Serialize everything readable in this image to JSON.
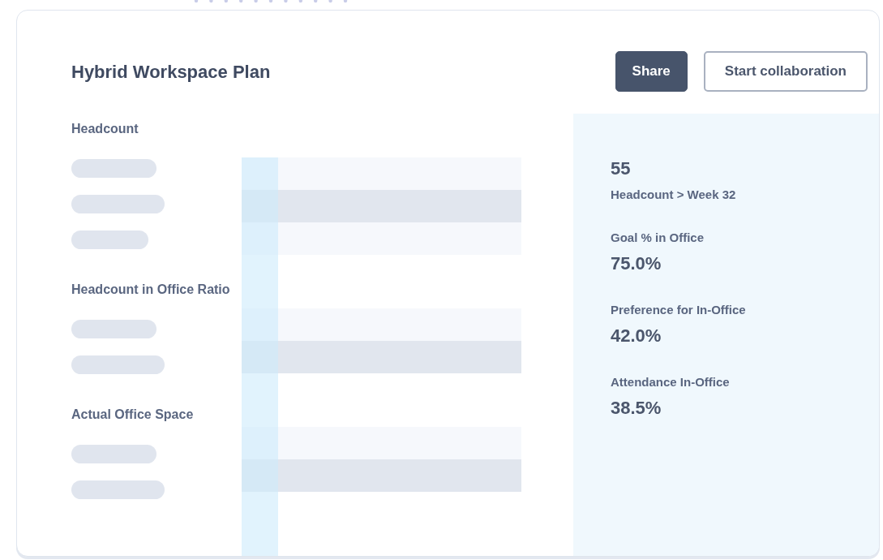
{
  "title": "Hybrid Workspace Plan",
  "buttons": [
    {
      "label": "Share",
      "kind": "primary"
    },
    {
      "label": "Start collaboration",
      "kind": "outline"
    }
  ],
  "sections": [
    {
      "label": "Headcount",
      "rows": [
        {
          "kind": "skeleton"
        },
        {
          "kind": "skeleton"
        },
        {
          "kind": "skeleton"
        }
      ]
    },
    {
      "label": "Headcount in Office Ratio",
      "rows": [
        {
          "kind": "skeleton"
        },
        {
          "kind": "skeleton"
        }
      ]
    },
    {
      "label": "Actual Office Space",
      "rows": [
        {
          "kind": "skeleton"
        },
        {
          "kind": "skeleton"
        }
      ]
    }
  ],
  "stats": [
    {
      "kind": "value_first",
      "value": "55",
      "label": "Headcount > Week 32"
    },
    {
      "kind": "label_first",
      "label": "Goal % in Office",
      "value": "75.0%"
    },
    {
      "kind": "label_first",
      "label": "Preference for In-Office",
      "value": "42.0%"
    },
    {
      "kind": "label_first",
      "label": "Attendance In-Office",
      "value": "38.5%"
    }
  ]
}
